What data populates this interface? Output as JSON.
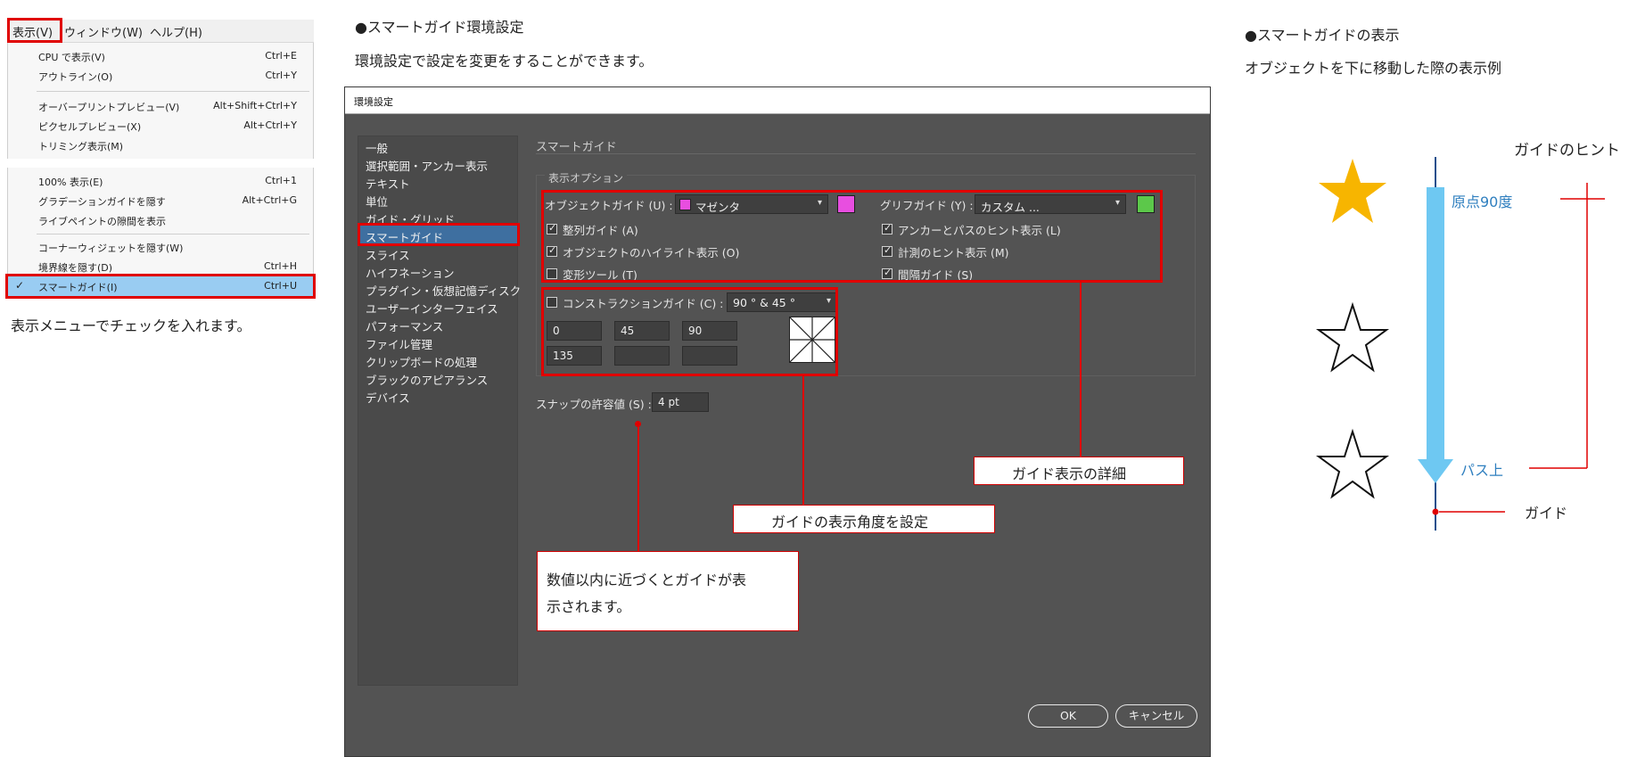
{
  "menu": {
    "bar": [
      "表示(V)",
      "ウィンドウ(W)",
      "ヘルプ(H)"
    ],
    "items_top": [
      {
        "label": "CPU で表示(V)",
        "shortcut": "Ctrl+E"
      },
      {
        "label": "アウトライン(O)",
        "shortcut": "Ctrl+Y"
      },
      {
        "label": "オーバープリントプレビュー(V)",
        "shortcut": "Alt+Shift+Ctrl+Y"
      },
      {
        "label": "ピクセルプレビュー(X)",
        "shortcut": "Alt+Ctrl+Y"
      },
      {
        "label": "トリミング表示(M)",
        "shortcut": ""
      }
    ],
    "items_bottom": [
      {
        "label": "100% 表示(E)",
        "shortcut": "Ctrl+1"
      },
      {
        "label": "グラデーションガイドを隠す",
        "shortcut": "Alt+Ctrl+G"
      },
      {
        "label": "ライブペイントの隙間を表示",
        "shortcut": ""
      },
      {
        "label": "コーナーウィジェットを隠す(W)",
        "shortcut": ""
      },
      {
        "label": "境界線を隠す(D)",
        "shortcut": "Ctrl+H"
      },
      {
        "label": "スマートガイド(I)",
        "shortcut": "Ctrl+U",
        "checked": true
      }
    ],
    "caption": "表示メニューでチェックを入れます。"
  },
  "middle": {
    "heading": "●スマートガイド環境設定",
    "subheading": "環境設定で設定を変更をすることができます。"
  },
  "dialog": {
    "title": "環境設定",
    "nav": [
      "一般",
      "選択範囲・アンカー表示",
      "テキスト",
      "単位",
      "ガイド・グリッド",
      "スマートガイド",
      "スライス",
      "ハイフネーション",
      "プラグイン・仮想記憶ディスク",
      "ユーザーインターフェイス",
      "パフォーマンス",
      "ファイル管理",
      "クリップボードの処理",
      "ブラックのアピアランス",
      "デバイス"
    ],
    "section_title": "スマートガイド",
    "group_title": "表示オプション",
    "object_guide_label": "オブジェクトガイド (U) :",
    "object_guide_value": "マゼンタ",
    "glyph_guide_label": "グリフガイド (Y) :",
    "glyph_guide_value": "カスタム ...",
    "checks_left": [
      "整列ガイド (A)",
      "オブジェクトのハイライト表示 (O)",
      "変形ツール (T)"
    ],
    "checks_right": [
      "アンカーとパスのヒント表示 (L)",
      "計測のヒント表示 (M)",
      "間隔ガイド (S)"
    ],
    "construction_label": "コンストラクションガイド (C) :",
    "construction_value": "90 ° & 45 °",
    "angles": [
      "0",
      "45",
      "90",
      "135",
      "",
      ""
    ],
    "snap_label": "スナップの許容値 (S) :",
    "snap_value": "4 pt",
    "ok": "OK",
    "cancel": "キャンセル",
    "colors": {
      "magenta": "#e84ee0",
      "green": "#5cc84a",
      "selection": "#3e6fa0"
    }
  },
  "callouts": {
    "guide_detail": "ガイド表示の詳細",
    "guide_angle": "ガイドの表示角度を設定",
    "snap_line1": "数値以内に近づくとガイドが表",
    "snap_line2": "示されます。"
  },
  "example": {
    "heading": "●スマートガイドの表示",
    "subheading": "オブジェクトを下に移動した際の表示例",
    "hint_label": "ガイドのヒント",
    "origin_label": "原点90度",
    "on_path_label": "パス上",
    "guide_label": "ガイド",
    "colors": {
      "star": "#f7b500",
      "arrow": "#6ec8f2",
      "guide_line": "#1d4f8c",
      "hint_text": "#2f7fbf"
    }
  }
}
